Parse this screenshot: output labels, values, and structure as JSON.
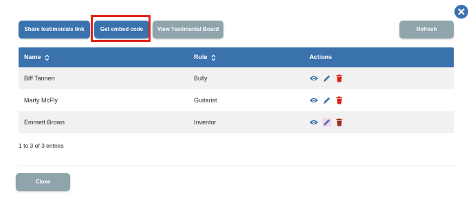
{
  "toolbar": {
    "share_label": "Share testimonials link",
    "embed_label": "Get embed code",
    "view_board_label": "View Testimonial Board",
    "refresh_label": "Refresh"
  },
  "table": {
    "headers": {
      "name": "Name",
      "role": "Role",
      "actions": "Actions"
    },
    "rows": [
      {
        "name": "Biff Tannen",
        "role": "Bully"
      },
      {
        "name": "Marty McFly",
        "role": "Guitarist"
      },
      {
        "name": "Emmett Brown",
        "role": "Inventor"
      }
    ],
    "action_icons": [
      "eye-icon",
      "pencil-icon",
      "trash-icon"
    ]
  },
  "footer": {
    "entries_text": "1 to 3 of 3 entries",
    "close_label": "Close"
  },
  "colors": {
    "primary": "#3a72ad",
    "secondary": "#8fa4ab",
    "danger": "#e0211a",
    "highlight": "#e0211a"
  }
}
